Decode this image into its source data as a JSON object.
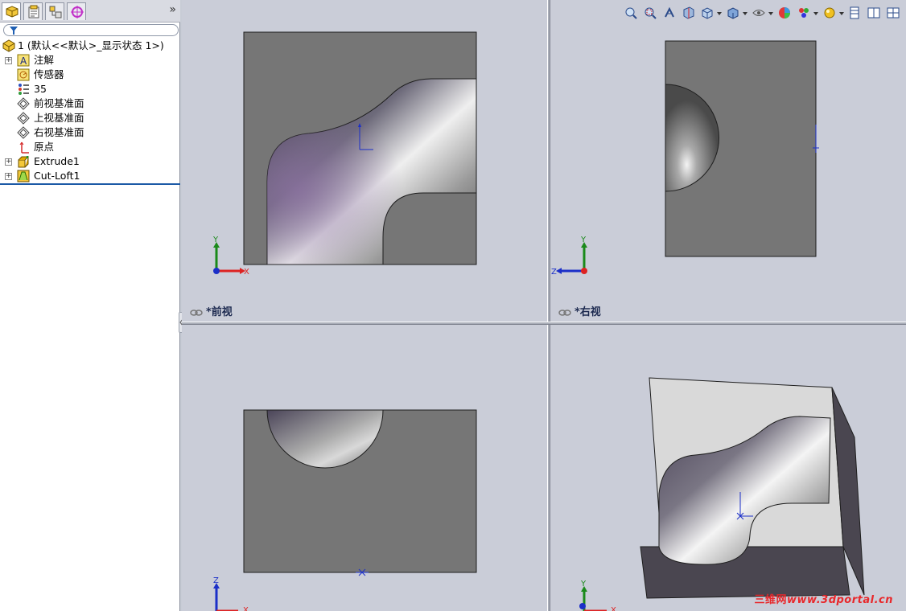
{
  "feature_tree": {
    "root_label": "1  (默认<<默认>_显示状态 1>)",
    "items": [
      {
        "label": "注解",
        "icon": "annotations-icon",
        "expandable": true
      },
      {
        "label": "传感器",
        "icon": "sensor-icon",
        "expandable": false
      },
      {
        "label": "35",
        "icon": "material-icon",
        "expandable": false
      },
      {
        "label": "前视基准面",
        "icon": "plane-icon",
        "expandable": false
      },
      {
        "label": "上视基准面",
        "icon": "plane-icon",
        "expandable": false
      },
      {
        "label": "右视基准面",
        "icon": "plane-icon",
        "expandable": false
      },
      {
        "label": "原点",
        "icon": "origin-icon",
        "expandable": false
      },
      {
        "label": "Extrude1",
        "icon": "extrude-feature-icon",
        "expandable": true
      },
      {
        "label": "Cut-Loft1",
        "icon": "cut-loft-feature-icon",
        "expandable": true
      }
    ],
    "expand_arrows": "»"
  },
  "viewports": {
    "front": {
      "label": "*前视"
    },
    "right": {
      "label": "*右视"
    }
  },
  "triad": {
    "front": {
      "v": "Y",
      "h": "X"
    },
    "right": {
      "v": "Y",
      "h": "Z"
    },
    "top": {
      "v": "Z",
      "h": "X"
    },
    "iso": {
      "v": "Y",
      "h": "X"
    }
  },
  "toolbar_icons": [
    "zoom-to-fit-icon",
    "zoom-to-area-icon",
    "previous-view-icon",
    "section-view-icon",
    "view-orientation-icon",
    "display-style-icon",
    "hide-show-items-icon",
    "edit-appearance-icon",
    "apply-scene-icon",
    "view-settings-icon",
    "single-view-icon",
    "two-view-icon",
    "four-view-icon"
  ],
  "watermark": {
    "cn": "三维网",
    "url": "www.3dportal.cn"
  },
  "colors": {
    "accent": "#1c5aa6",
    "model_face": "#767676",
    "viewport_bg": "#cacdd8"
  }
}
